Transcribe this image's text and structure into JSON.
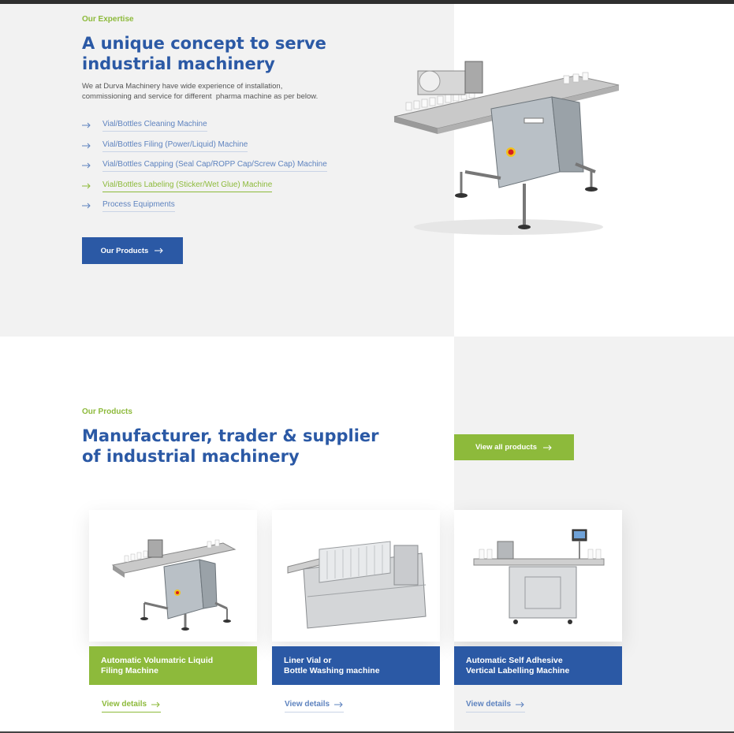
{
  "expertise": {
    "eyebrow": "Our Expertise",
    "heading_line1": "A unique concept to serve",
    "heading_line2": "industrial machinery",
    "intro_line1": "We at Durva Machinery have wide experience of installation,",
    "intro_line2": "commissioning and service for different  pharma machine as per below.",
    "services": [
      {
        "label": "Vial/Bottles Cleaning Machine",
        "active": false
      },
      {
        "label": "Vial/Bottles Filing (Power/Liquid) Machine",
        "active": false
      },
      {
        "label": "Vial/Bottles Capping (Seal Cap/ROPP Cap/Screw Cap) Machine",
        "active": false
      },
      {
        "label": "Vial/Bottles Labeling (Sticker/Wet Glue) Machine",
        "active": true
      },
      {
        "label": "Process Equipments",
        "active": false
      }
    ],
    "button_label": "Our Products"
  },
  "products": {
    "eyebrow": "Our Products",
    "heading_line1": "Manufacturer, trader & supplier",
    "heading_line2": "of industrial machinery",
    "view_all_label": "View all products",
    "cards": [
      {
        "title_line1": "Automatic Volumatric Liquid",
        "title_line2": "Filing Machine",
        "link": "View details",
        "color": "green"
      },
      {
        "title_line1": "Liner Vial or",
        "title_line2": "Bottle Washing machine",
        "link": "View details",
        "color": "blue"
      },
      {
        "title_line1": "Automatic Self Adhesive",
        "title_line2": "Vertical Labelling Machine",
        "link": "View details",
        "color": "blue"
      }
    ]
  },
  "colors": {
    "brand_blue": "#2b59a5",
    "brand_green": "#8dba3b",
    "panel_gray": "#f2f2f2"
  },
  "icons": {
    "arrow": "arrow-right-icon"
  }
}
